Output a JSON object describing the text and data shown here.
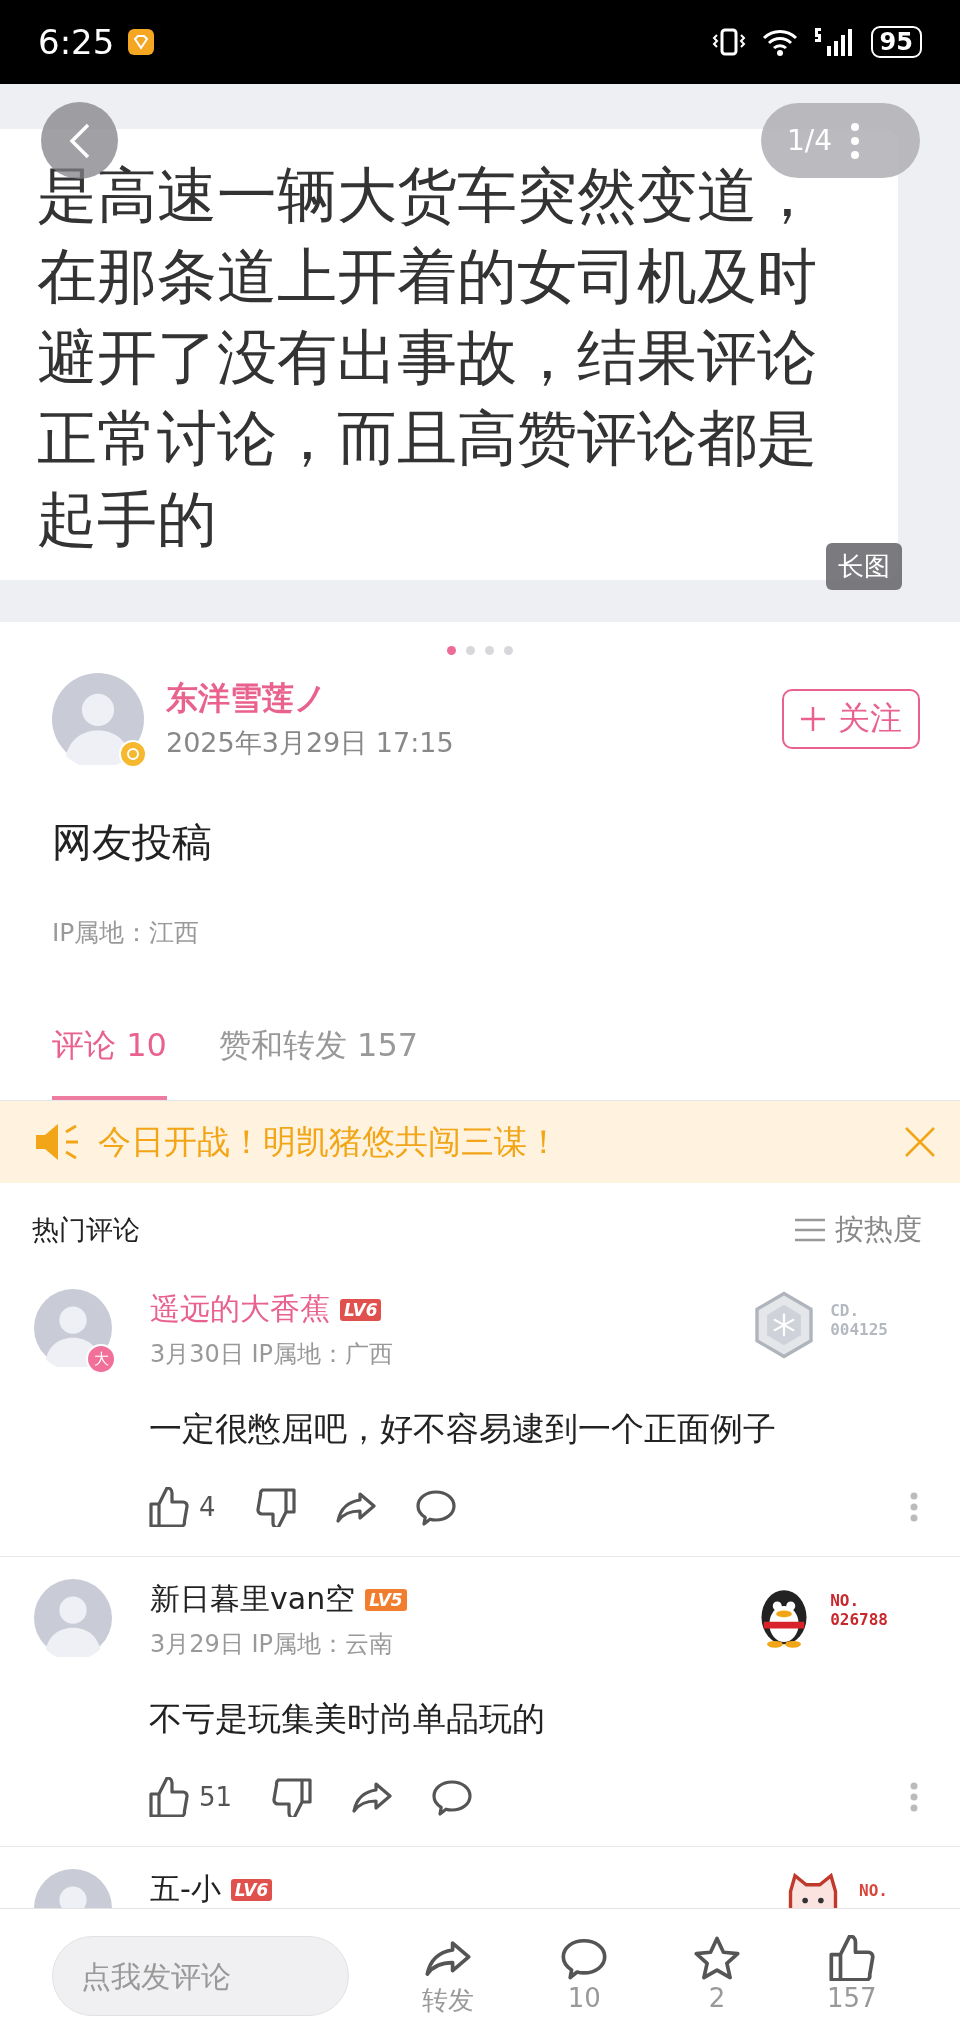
{
  "status_bar": {
    "time": "6:25",
    "battery": "95"
  },
  "image_viewer": {
    "counter": "1/4",
    "long_image_badge": "长图",
    "lines": [
      "是高速一辆大货车突然变道，",
      "在那条道上开着的女司机及时",
      "避开了没有出事故，结果评论",
      "正常讨论，而且高赞评论都是",
      "起手的"
    ],
    "pages": [
      {
        "selected": true
      },
      {
        "selected": false
      },
      {
        "selected": false
      },
      {
        "selected": false
      }
    ]
  },
  "post": {
    "author": "东洋雪莲ノ",
    "date": "2025年3月29日 17:15",
    "follow_button": "关注",
    "content": "网友投稿",
    "ip": "IP属地：江西"
  },
  "tabs": [
    {
      "label": "评论 10",
      "selected": true
    },
    {
      "label": "赞和转发 157",
      "selected": false
    }
  ],
  "banner": {
    "text": "今日开战！明凯猪悠共闯三谋！"
  },
  "comments_header": {
    "title": "热门评论",
    "sort": "按热度"
  },
  "comments": [
    {
      "name": "遥远的大香蕉",
      "vip": true,
      "level": "LV6",
      "color": "#e0504c",
      "avatar_badge": "大",
      "meta": "3月30日 IP属地：广西",
      "text": "一定很憋屈吧，好不容易逮到一个正面例子",
      "likes": "4",
      "fan_badge": {
        "kind": "hexagon",
        "label": "CD.",
        "number": "004125",
        "color": "#b4b8c0"
      }
    },
    {
      "name": "新日暮里van空",
      "vip": false,
      "level": "LV5",
      "color": "#f07e2e",
      "meta": "3月29日 IP属地：云南",
      "text": "不亏是玩集美时尚单品玩的",
      "likes": "51",
      "fan_badge": {
        "kind": "penguin",
        "label": "NO.",
        "number": "026788",
        "color": "#c8282c"
      }
    },
    {
      "name": "五-小",
      "vip": false,
      "level": "LV6",
      "color": "#e0504c",
      "fan_badge": {
        "kind": "cat",
        "label": "NO.",
        "color": "#d9453b"
      }
    }
  ],
  "bottom_bar": {
    "placeholder": "点我发评论",
    "actions": [
      {
        "kind": "share",
        "label": "转发"
      },
      {
        "kind": "comment",
        "label": "10"
      },
      {
        "kind": "star",
        "label": "2"
      },
      {
        "kind": "like",
        "label": "157"
      }
    ]
  }
}
